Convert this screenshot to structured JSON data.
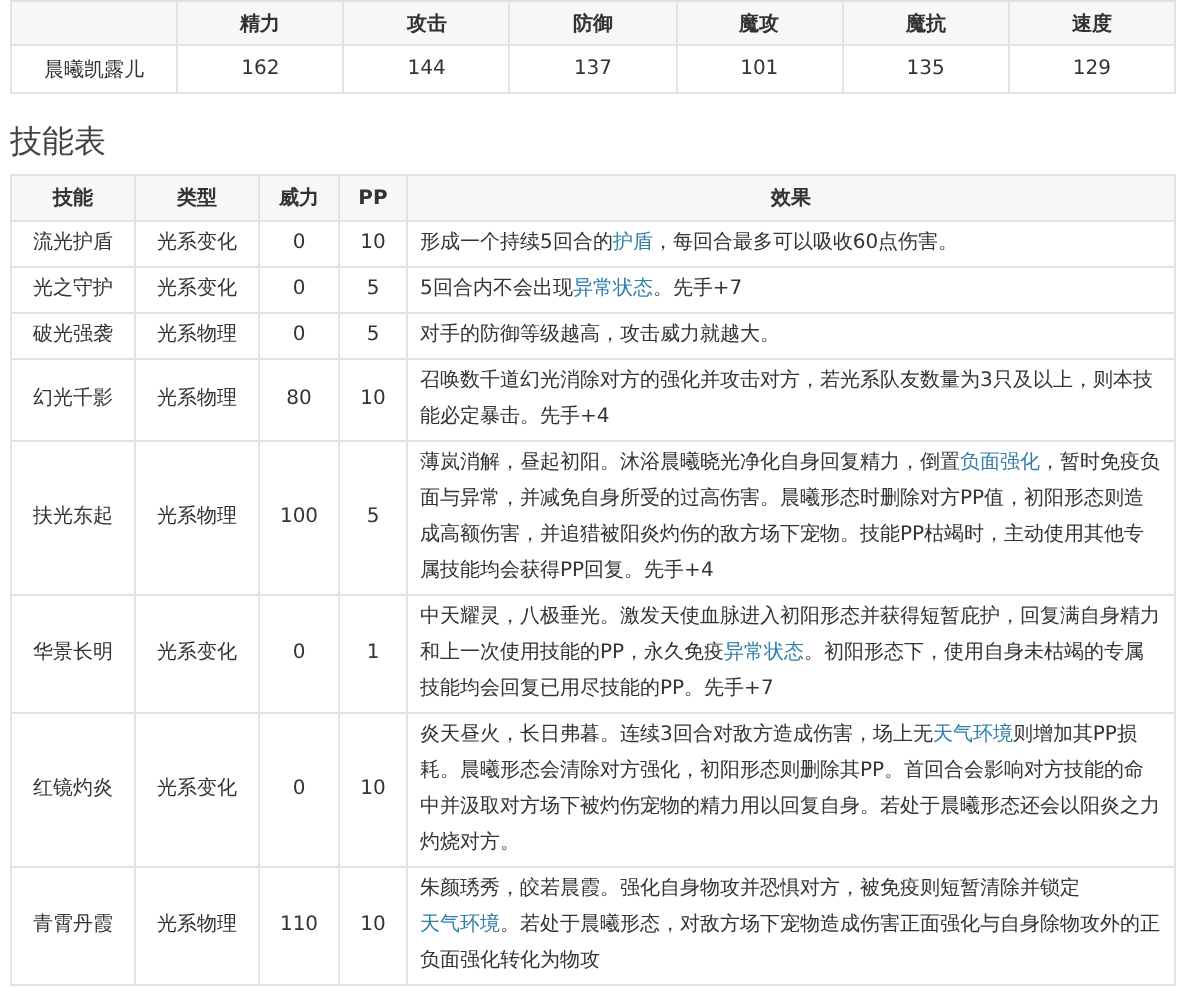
{
  "stats_table": {
    "columns": [
      "",
      "精力",
      "攻击",
      "防御",
      "魔攻",
      "魔抗",
      "速度"
    ],
    "rows": [
      [
        "晨曦凯露儿",
        "162",
        "144",
        "137",
        "101",
        "135",
        "129"
      ]
    ]
  },
  "skills_title": "技能表",
  "skills_table": {
    "columns": [
      "技能",
      "类型",
      "威力",
      "PP",
      "效果"
    ],
    "rows": [
      {
        "name": "流光护盾",
        "type": "光系变化",
        "power": "0",
        "pp": "10",
        "effect": [
          {
            "kind": "text",
            "text": "形成一个持续5回合的"
          },
          {
            "kind": "link",
            "text": "护盾"
          },
          {
            "kind": "text",
            "text": "，每回合最多可以吸收60点伤害。"
          }
        ]
      },
      {
        "name": "光之守护",
        "type": "光系变化",
        "power": "0",
        "pp": "5",
        "effect": [
          {
            "kind": "text",
            "text": "5回合内不会出现"
          },
          {
            "kind": "link",
            "text": "异常状态"
          },
          {
            "kind": "text",
            "text": "。先手+7"
          }
        ]
      },
      {
        "name": "破光强袭",
        "type": "光系物理",
        "power": "0",
        "pp": "5",
        "effect": [
          {
            "kind": "text",
            "text": "对手的防御等级越高，攻击威力就越大。"
          }
        ]
      },
      {
        "name": "幻光千影",
        "type": "光系物理",
        "power": "80",
        "pp": "10",
        "effect": [
          {
            "kind": "text",
            "text": "召唤数千道幻光消除对方的强化并攻击对方，若光系队友数量为3只及以上，则本技能必定暴击。先手+4"
          }
        ]
      },
      {
        "name": "扶光东起",
        "type": "光系物理",
        "power": "100",
        "pp": "5",
        "effect": [
          {
            "kind": "text",
            "text": "薄岚消解，昼起初阳。沐浴晨曦晓光净化自身回复精力，倒置"
          },
          {
            "kind": "link",
            "text": "负面强化"
          },
          {
            "kind": "text",
            "text": "，暂时免疫负面与异常，并减免自身所受的过高伤害。晨曦形态时删除对方PP值，初阳形态则造成高额伤害，并追猎被阳炎灼伤的敌方场下宠物。技能PP枯竭时，主动使用其他专属技能均会获得PP回复。先手+4"
          }
        ]
      },
      {
        "name": "华景长明",
        "type": "光系变化",
        "power": "0",
        "pp": "1",
        "effect": [
          {
            "kind": "text",
            "text": "中天耀灵，八极垂光。激发天使血脉进入初阳形态并获得短暂庇护，回复满自身精力和上一次使用技能的PP，永久免疫"
          },
          {
            "kind": "link",
            "text": "异常状态"
          },
          {
            "kind": "text",
            "text": "。初阳形态下，使用自身未枯竭的专属技能均会回复已用尽技能的PP。先手+7"
          }
        ]
      },
      {
        "name": "红镜灼炎",
        "type": "光系变化",
        "power": "0",
        "pp": "10",
        "effect": [
          {
            "kind": "text",
            "text": "炎天昼火，长日弗暮。连续3回合对敌方造成伤害，场上无"
          },
          {
            "kind": "link",
            "text": "天气环境"
          },
          {
            "kind": "text",
            "text": "则增加其PP损耗。晨曦形态会清除对方强化，初阳形态则删除其PP。首回合会影响对方技能的命中并汲取对方场下被灼伤宠物的精力用以回复自身。若处于晨曦形态还会以阳炎之力灼烧对方。"
          }
        ]
      },
      {
        "name": "青霄丹霞",
        "type": "光系物理",
        "power": "110",
        "pp": "10",
        "effect": [
          {
            "kind": "text",
            "text": "朱颜琇秀，皎若晨霞。强化自身物攻并恐惧对方，被免疫则短暂清除并锁定"
          },
          {
            "kind": "link",
            "text": "天气环境"
          },
          {
            "kind": "text",
            "text": "。若处于晨曦形态，对敌方场下宠物造成伤害正面强化与自身除物攻外的正负面强化转化为物攻"
          }
        ]
      }
    ]
  }
}
